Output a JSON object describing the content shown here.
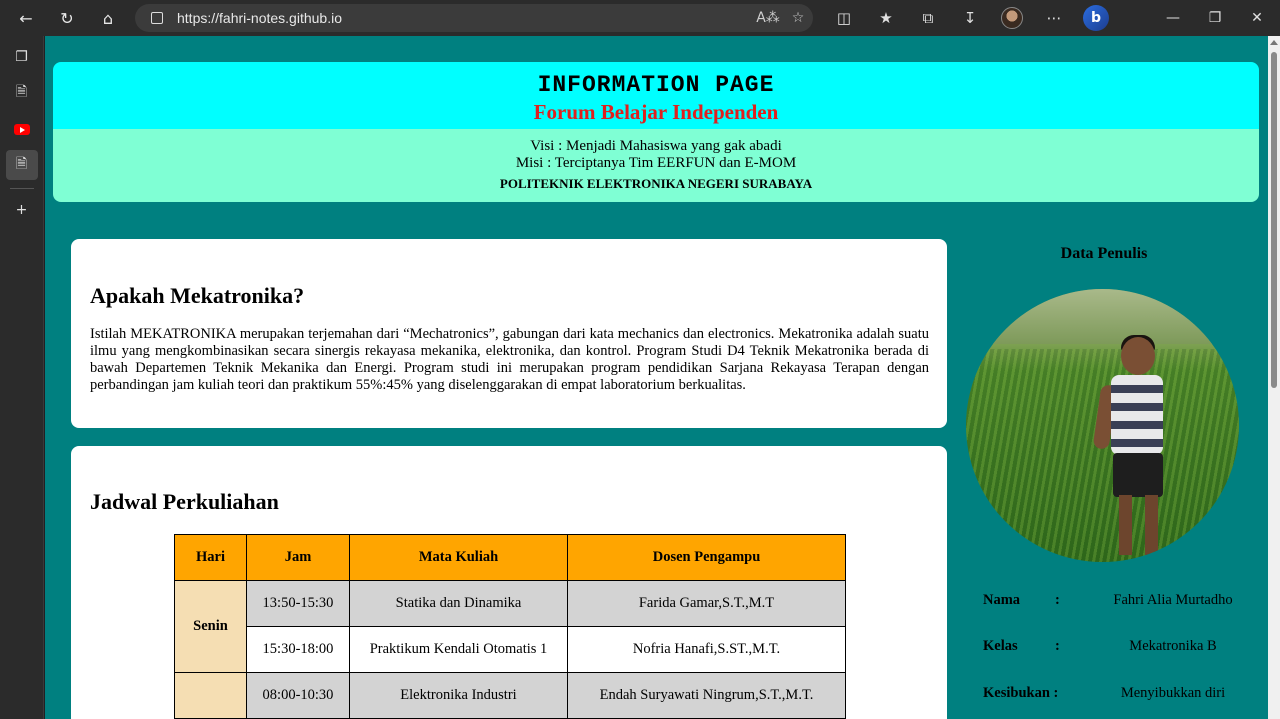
{
  "browser": {
    "url": "https://fahri-notes.github.io"
  },
  "header": {
    "title": "INFORMATION PAGE",
    "subtitle": "Forum Belajar Independen",
    "visi": "Visi : Menjadi Mahasiswa yang gak abadi",
    "misi": "Misi : Terciptanya Tim EERFUN dan E-MOM",
    "institution": "POLITEKNIK ELEKTRONIKA NEGERI SURABAYA"
  },
  "about": {
    "heading": "Apakah Mekatronika?",
    "body": "Istilah MEKATRONIKA merupakan terjemahan dari “Mechatronics”, gabungan dari kata mechanics dan electronics. Mekatronika adalah suatu ilmu yang mengkombinasikan secara sinergis rekayasa mekanika, elektronika, dan kontrol. Program Studi D4 Teknik Mekatronika berada di bawah Departemen Teknik Mekanika dan Energi. Program studi ini merupakan program pendidikan Sarjana Rekayasa Terapan dengan perbandingan jam kuliah teori dan praktikum 55%:45% yang diselenggarakan di empat laboratorium berkualitas."
  },
  "schedule": {
    "heading": "Jadwal Perkuliahan",
    "columns": [
      "Hari",
      "Jam",
      "Mata Kuliah",
      "Dosen Pengampu"
    ],
    "rows": [
      {
        "day": "Senin",
        "time": "13:50-15:30",
        "course": "Statika dan Dinamika",
        "lecturer": "Farida Gamar,S.T.,M.T"
      },
      {
        "day": "",
        "time": "15:30-18:00",
        "course": "Praktikum Kendali Otomatis 1",
        "lecturer": "Nofria Hanafi,S.ST.,M.T."
      },
      {
        "day": "",
        "time": "08:00-10:30",
        "course": "Elektronika Industri",
        "lecturer": "Endah Suryawati Ningrum,S.T.,M.T."
      }
    ]
  },
  "author": {
    "heading": "Data Penulis",
    "fields": [
      {
        "label": "Nama",
        "colon": ":",
        "value": "Fahri Alia Murtadho"
      },
      {
        "label": "Kelas",
        "colon": ":",
        "value": "Mekatronika B"
      },
      {
        "label": "Kesibukan :",
        "colon": "",
        "value": "Menyibukkan diri"
      }
    ]
  }
}
